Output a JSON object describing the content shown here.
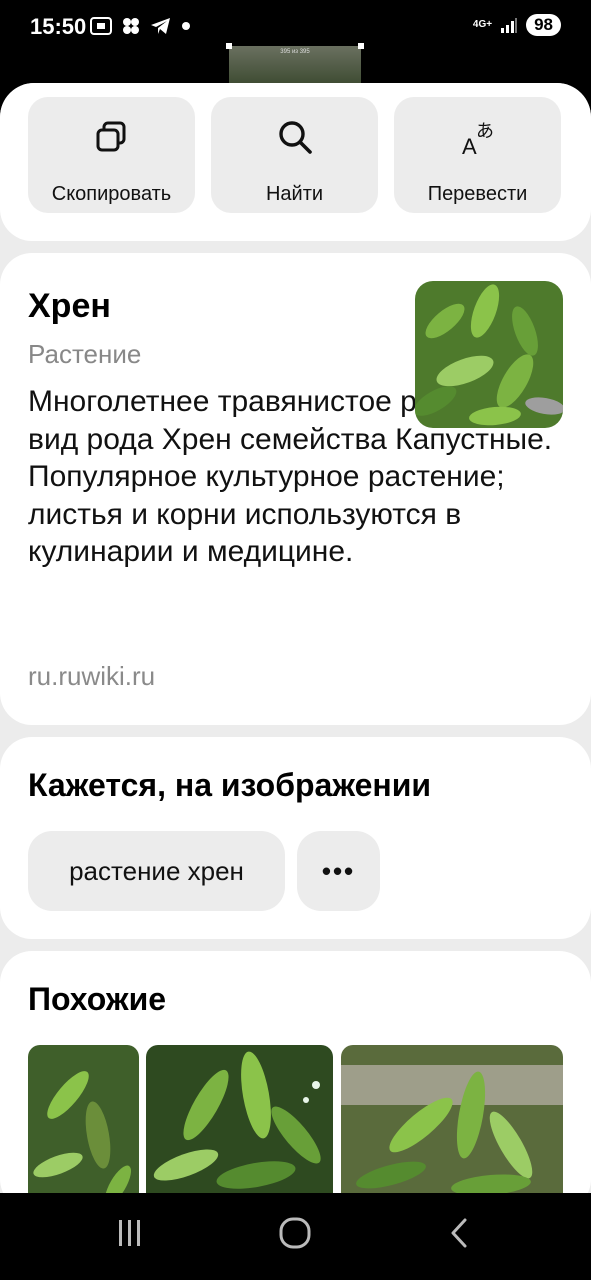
{
  "status_bar": {
    "time": "15:50",
    "network": "4G+",
    "battery": "98",
    "preview_caption": "395 из 395"
  },
  "actions": [
    {
      "label": "Скопировать",
      "icon": "copy-icon"
    },
    {
      "label": "Найти",
      "icon": "search-icon"
    },
    {
      "label": "Перевести",
      "icon": "translate-icon"
    }
  ],
  "info": {
    "title": "Хрен",
    "subtitle": "Растение",
    "description": "Многолетнее травянистое растение, вид рода Хрен семейства Капустные. Популярное культурное растение; листья и корни используются в кулинарии и медицине.",
    "source": "ru.ruwiki.ru"
  },
  "seems": {
    "heading": "Кажется, на изображении",
    "chips": [
      "растение хрен"
    ],
    "more_label": "•••"
  },
  "similar": {
    "heading": "Похожие"
  },
  "colors": {
    "sheet_bg": "#ececec",
    "card_bg": "#ffffff",
    "chip_bg": "#ececec",
    "secondary_text": "#888888"
  }
}
